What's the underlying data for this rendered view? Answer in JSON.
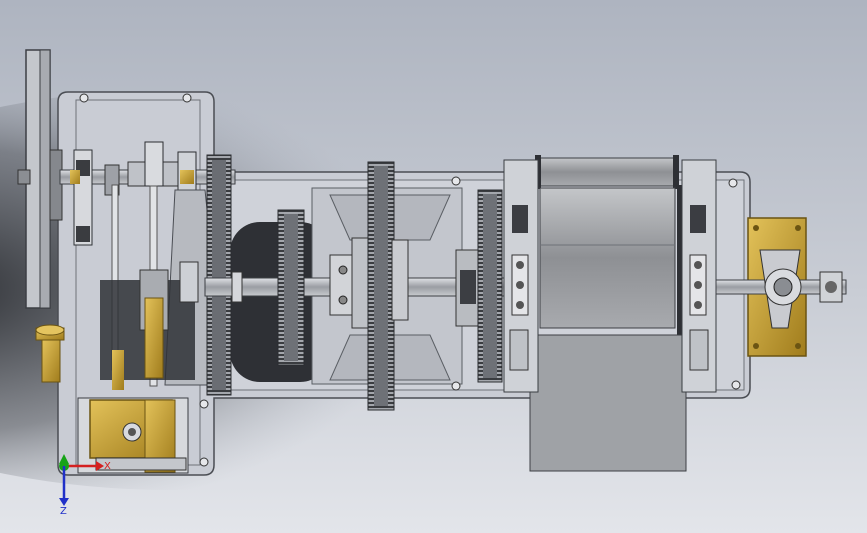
{
  "triad": {
    "x_label": "X",
    "y_label": "",
    "z_label": "Z"
  },
  "colors": {
    "background_top": "#b8bcc6",
    "background_bottom": "#dfe2e8",
    "frame": "#c9ccd4",
    "metal_dark": "#2b2d31",
    "brass": "#c7a234",
    "drum": "#9d9fa3",
    "x_axis": "#d42020",
    "y_axis": "#17a317",
    "z_axis": "#2030c8"
  }
}
